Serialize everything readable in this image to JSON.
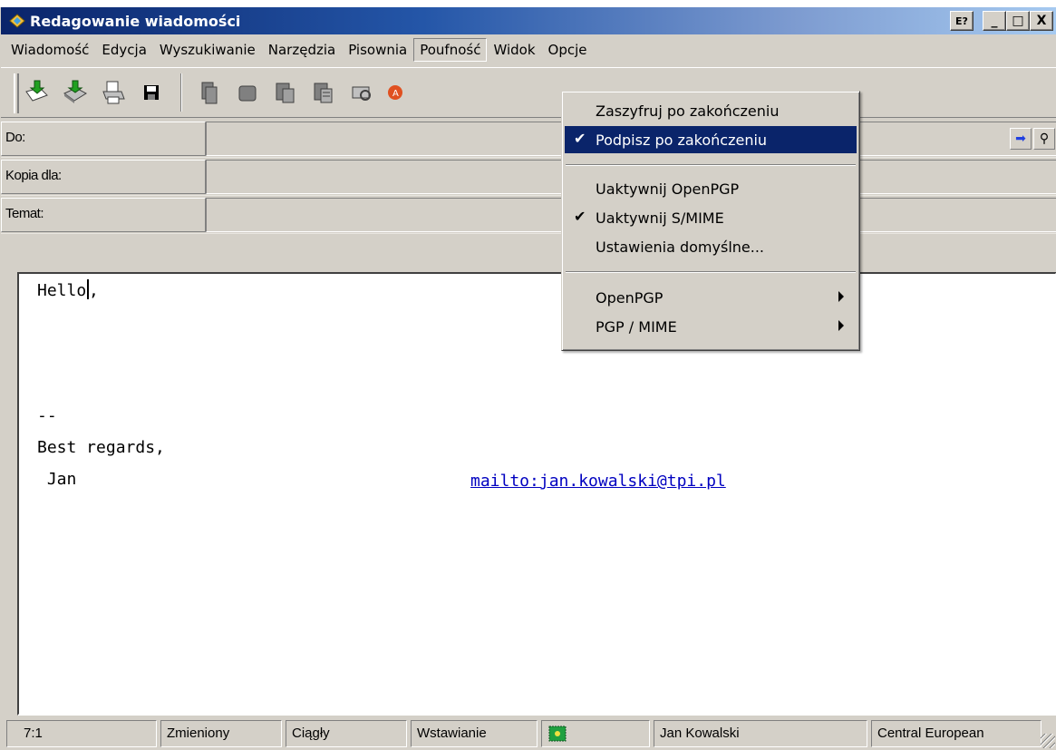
{
  "window": {
    "title": "Redagowanie wiadomości",
    "title_buttons": [
      "E?",
      "_",
      "□",
      "X"
    ]
  },
  "menu": [
    "Wiadomość",
    "Edycja",
    "Wyszukiwanie",
    "Narzędzia",
    "Pisownia",
    "Poufność",
    "Widok",
    "Opcje"
  ],
  "toolbar": {
    "icons": [
      "send-now-icon",
      "send-later-icon",
      "print-icon",
      "save-icon",
      "cut-icon",
      "copy-icon",
      "paste-icon",
      "paste-quote-icon",
      "find-icon",
      "spell-icon",
      "delete-icon"
    ]
  },
  "fields": {
    "to_label": "Do:",
    "cc_label": "Kopia dla:",
    "subject_label": "Temat:"
  },
  "editor": {
    "line1": "Hello ,",
    "sig_sep": "--",
    "line_regards": "Best regards,",
    "line_name": " Jan",
    "mailto": "mailto:jan.kowalski@tpi.pl"
  },
  "dropdown": {
    "items": [
      {
        "label": "Zaszyfruj po zakończeniu",
        "checked": false,
        "submenu": false
      },
      {
        "label": "Podpisz po zakończeniu",
        "checked": true,
        "submenu": false
      },
      {
        "label": "Uaktywnij OpenPGP",
        "checked": false,
        "submenu": false
      },
      {
        "label": "Uaktywnij S/MIME",
        "checked": true,
        "submenu": false
      },
      {
        "label": "Ustawienia domyślne...",
        "checked": false,
        "submenu": false
      },
      {
        "label": "OpenPGP",
        "checked": false,
        "submenu": true
      },
      {
        "label": "PGP / MIME",
        "checked": false,
        "submenu": true
      }
    ],
    "check_glyph": "✔"
  },
  "status": {
    "position": "7:1",
    "modified": "Zmieniony",
    "mode": "Ciągły",
    "insert": "Wstawianie",
    "user": "Jan Kowalski",
    "charset": "Central European"
  },
  "colors": {
    "titlebar_start": "#0a246a",
    "highlight": "#0a246a",
    "link": "#0000c0",
    "face": "#d4d0c8"
  }
}
